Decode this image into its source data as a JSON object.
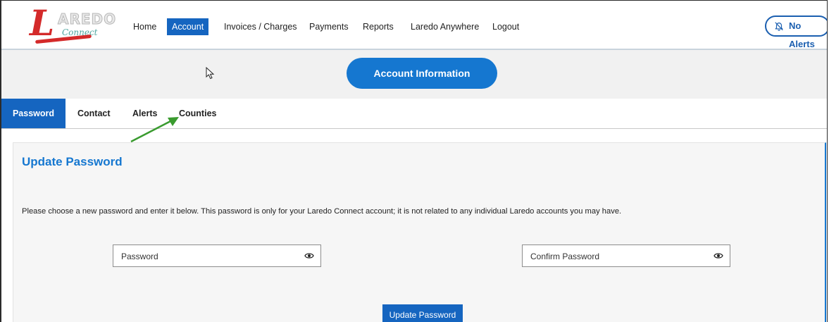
{
  "logo": {
    "big_letter": "L",
    "letters": "AREDO",
    "script": "Connect"
  },
  "nav": {
    "items": [
      {
        "label": "Home",
        "active": false
      },
      {
        "label": "Account",
        "active": true
      },
      {
        "label": "Invoices / Charges",
        "active": false
      },
      {
        "label": "Payments",
        "active": false
      },
      {
        "label": "Reports",
        "active": false
      },
      {
        "label": "Laredo Anywhere",
        "active": false
      },
      {
        "label": "Logout",
        "active": false
      }
    ],
    "alerts_label": "No Alerts"
  },
  "banner": {
    "account_info_label": "Account Information"
  },
  "tabs": [
    {
      "label": "Password",
      "active": true
    },
    {
      "label": "Contact",
      "active": false
    },
    {
      "label": "Alerts",
      "active": false
    },
    {
      "label": "Counties",
      "active": false
    }
  ],
  "card": {
    "title": "Update Password",
    "description": "Please choose a new password and enter it below. This password is only for your Laredo Connect account; it is not related to any individual Laredo accounts you may have.",
    "password_placeholder": "Password",
    "confirm_placeholder": "Confirm Password",
    "submit_label": "Update Password"
  },
  "colors": {
    "primary": "#1565c0",
    "accent": "#1577d0",
    "logo_red": "#d42a2a",
    "annotation_arrow": "#3a9b2f"
  },
  "icons": {
    "alerts": "bell-slash-icon",
    "reveal": "eye-icon",
    "cursor": "mouse-pointer-icon",
    "annotation": "green-arrow-icon"
  }
}
